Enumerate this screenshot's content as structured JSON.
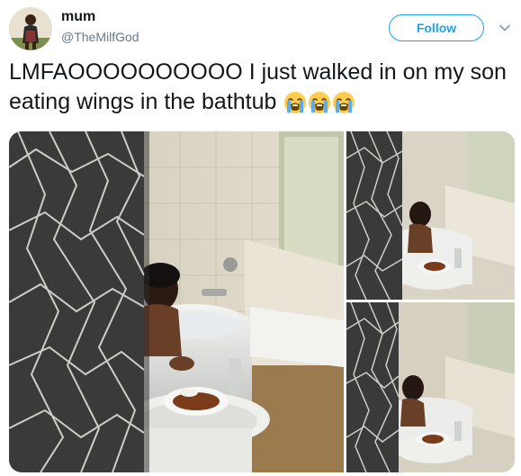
{
  "user": {
    "display_name": "mum",
    "screen_name": "@TheMilfGod",
    "avatar_icon": "profile-photo-avatar"
  },
  "actions": {
    "follow_label": "Follow",
    "menu_icon": "chevron-down-icon"
  },
  "tweet": {
    "text": "LMFAOOOOOOOOOO I just walked in on my son eating wings in the bathtub",
    "emojis": [
      "loudly-crying-face",
      "loudly-crying-face",
      "loudly-crying-face"
    ]
  },
  "media": {
    "photos": [
      "photo-1",
      "photo-2",
      "photo-3"
    ]
  },
  "colors": {
    "accent": "#1da1f2",
    "text": "#14171a",
    "secondary": "#657786"
  }
}
